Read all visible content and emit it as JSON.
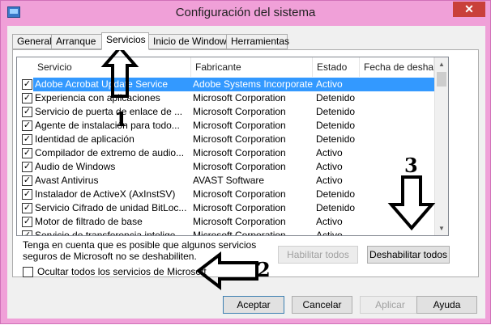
{
  "window": {
    "title": "Configuración del sistema",
    "close_glyph": "✕"
  },
  "tabs": [
    {
      "label": "General"
    },
    {
      "label": "Arranque"
    },
    {
      "label": "Servicios"
    },
    {
      "label": "Inicio de Windows"
    },
    {
      "label": "Herramientas"
    }
  ],
  "list": {
    "columns": [
      "Servicio",
      "Fabricante",
      "Estado",
      "Fecha de desha..."
    ],
    "rows": [
      {
        "checked": true,
        "service": "Adobe Acrobat Update Service",
        "maker": "Adobe Systems Incorporated",
        "status": "Activo"
      },
      {
        "checked": true,
        "service": "Experiencia con aplicaciones",
        "maker": "Microsoft Corporation",
        "status": "Detenido"
      },
      {
        "checked": true,
        "service": "Servicio de puerta de enlace de ...",
        "maker": "Microsoft Corporation",
        "status": "Detenido"
      },
      {
        "checked": true,
        "service": "Agente de instalación para todo...",
        "maker": "Microsoft Corporation",
        "status": "Detenido"
      },
      {
        "checked": true,
        "service": "Identidad de aplicación",
        "maker": "Microsoft Corporation",
        "status": "Detenido"
      },
      {
        "checked": true,
        "service": "Compilador de extremo de audio...",
        "maker": "Microsoft Corporation",
        "status": "Activo"
      },
      {
        "checked": true,
        "service": "Audio de Windows",
        "maker": "Microsoft Corporation",
        "status": "Activo"
      },
      {
        "checked": true,
        "service": "Avast Antivirus",
        "maker": "AVAST Software",
        "status": "Activo"
      },
      {
        "checked": true,
        "service": "Instalador de ActiveX (AxInstSV)",
        "maker": "Microsoft Corporation",
        "status": "Detenido"
      },
      {
        "checked": true,
        "service": "Servicio Cifrado de unidad BitLoc...",
        "maker": "Microsoft Corporation",
        "status": "Detenido"
      },
      {
        "checked": true,
        "service": "Motor de filtrado de base",
        "maker": "Microsoft Corporation",
        "status": "Activo"
      },
      {
        "checked": true,
        "service": "Servicio de transferencia intelige...",
        "maker": "Microsoft Corporation",
        "status": "Activo"
      }
    ]
  },
  "note": "Tenga en cuenta que es posible que algunos servicios seguros de Microsoft no se deshabiliten.",
  "buttons": {
    "enable_all": "Habilitar todos",
    "disable_all": "Deshabilitar todos",
    "ok": "Aceptar",
    "cancel": "Cancelar",
    "apply": "Aplicar",
    "help": "Ayuda"
  },
  "hide_ms": {
    "label": "Ocultar todos los servicios de Microsoft",
    "checked": false
  },
  "annotations": {
    "one": "1",
    "two": "2",
    "three": "3"
  }
}
